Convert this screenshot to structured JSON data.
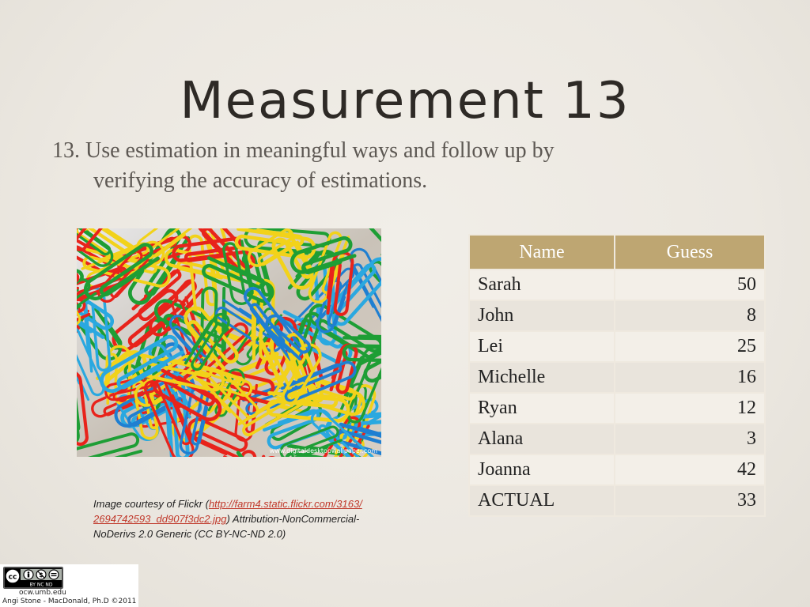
{
  "slide": {
    "title": "Measurement 13",
    "objective_line1": "13. Use estimation in meaningful ways and follow up by",
    "objective_line2": "verifying the accuracy of estimations."
  },
  "photo": {
    "subject": "pile of colorful paper clips",
    "watermark": "www.digitaldesktopwallpaper.com"
  },
  "credit": {
    "prefix": "Image courtesy of Flickr (",
    "link": "http://farm4.static.flickr.com/3163/2694742593_dd907f3dc2.jpg",
    "suffix": ") Attribution-NonCommercial-NoDerivs 2.0 Generic (CC BY-NC-ND 2.0)"
  },
  "table": {
    "headers": [
      "Name",
      "Guess"
    ],
    "rows": [
      {
        "name": "Sarah",
        "guess": "50"
      },
      {
        "name": "John",
        "guess": "8"
      },
      {
        "name": "Lei",
        "guess": "25"
      },
      {
        "name": "Michelle",
        "guess": "16"
      },
      {
        "name": "Ryan",
        "guess": "12"
      },
      {
        "name": "Alana",
        "guess": "3"
      },
      {
        "name": "Joanna",
        "guess": "42"
      },
      {
        "name": "ACTUAL",
        "guess": "33"
      }
    ]
  },
  "license": {
    "badge_text": "BY NC ND",
    "site": "ocw.umb.edu",
    "author": "Angi Stone - MacDonald, Ph.D ©2011"
  },
  "colors": {
    "table_header": "#bea672",
    "title_text": "#2e2a26",
    "link": "#c0392b"
  }
}
